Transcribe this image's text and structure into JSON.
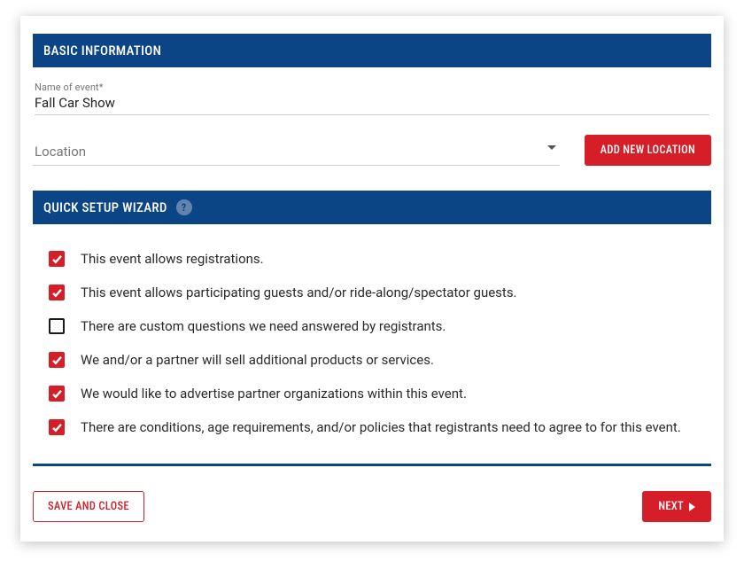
{
  "sections": {
    "basic_title": "BASIC INFORMATION",
    "wizard_title": "QUICK SETUP WIZARD"
  },
  "event_name": {
    "label": "Name of event*",
    "value": "Fall Car Show"
  },
  "location": {
    "placeholder": "Location",
    "add_button": "ADD NEW LOCATION"
  },
  "wizard": {
    "help_symbol": "?",
    "items": [
      {
        "checked": true,
        "label": "This event allows registrations."
      },
      {
        "checked": true,
        "label": "This event allows participating guests and/or ride-along/spectator guests."
      },
      {
        "checked": false,
        "label": "There are custom questions we need answered by registrants."
      },
      {
        "checked": true,
        "label": "We and/or a partner will sell additional products or services."
      },
      {
        "checked": true,
        "label": "We would like to advertise partner organizations within this event."
      },
      {
        "checked": true,
        "label": "There are conditions, age requirements, and/or policies that registrants need to agree to for this event."
      }
    ]
  },
  "buttons": {
    "save_close": "SAVE AND CLOSE",
    "next": "NEXT"
  }
}
